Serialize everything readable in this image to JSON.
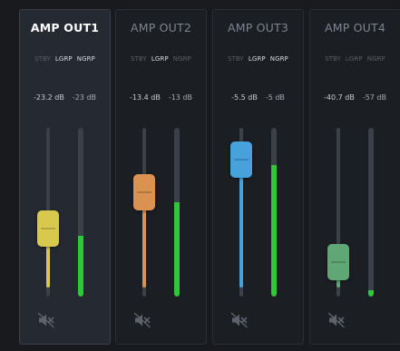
{
  "channels": [
    {
      "title": "AMP OUT1",
      "selected": true,
      "modes": [
        "STBY",
        "LGRP",
        "NGRP"
      ],
      "active_modes": [
        "LGRP",
        "NGRP"
      ],
      "fader_db": "-23.2 dB",
      "meter_db": "-23 dB",
      "fader_color": "#d9c84e",
      "fader_level": 0.38,
      "meter_level": 0.36,
      "mute_icon": "speaker-muted-icon"
    },
    {
      "title": "AMP OUT2",
      "selected": false,
      "modes": [
        "STBY",
        "LGRP",
        "NGRP"
      ],
      "active_modes": [
        "LGRP"
      ],
      "fader_db": "-13.4 dB",
      "meter_db": "-13 dB",
      "fader_color": "#db9150",
      "fader_level": 0.65,
      "meter_level": 0.56,
      "mute_icon": "speaker-muted-icon"
    },
    {
      "title": "AMP OUT3",
      "selected": false,
      "modes": [
        "STBY",
        "LGRP",
        "NGRP"
      ],
      "active_modes": [
        "LGRP",
        "NGRP"
      ],
      "fader_db": "-5.5 dB",
      "meter_db": "-5 dB",
      "fader_color": "#47a2dc",
      "fader_level": 0.9,
      "meter_level": 0.78,
      "mute_icon": "speaker-muted-icon"
    },
    {
      "title": "AMP OUT4",
      "selected": false,
      "modes": [
        "STBY",
        "LGRP",
        "NGRP"
      ],
      "active_modes": [],
      "fader_db": "-40.7 dB",
      "meter_db": "-57 dB",
      "fader_color": "#5fa775",
      "fader_level": 0.12,
      "meter_level": 0.04,
      "mute_icon": "speaker-muted-icon"
    }
  ],
  "colors": {
    "meter": "#2ec838",
    "background": "#181a1e",
    "panel": "#1b1e23",
    "panel_selected": "#252931"
  }
}
